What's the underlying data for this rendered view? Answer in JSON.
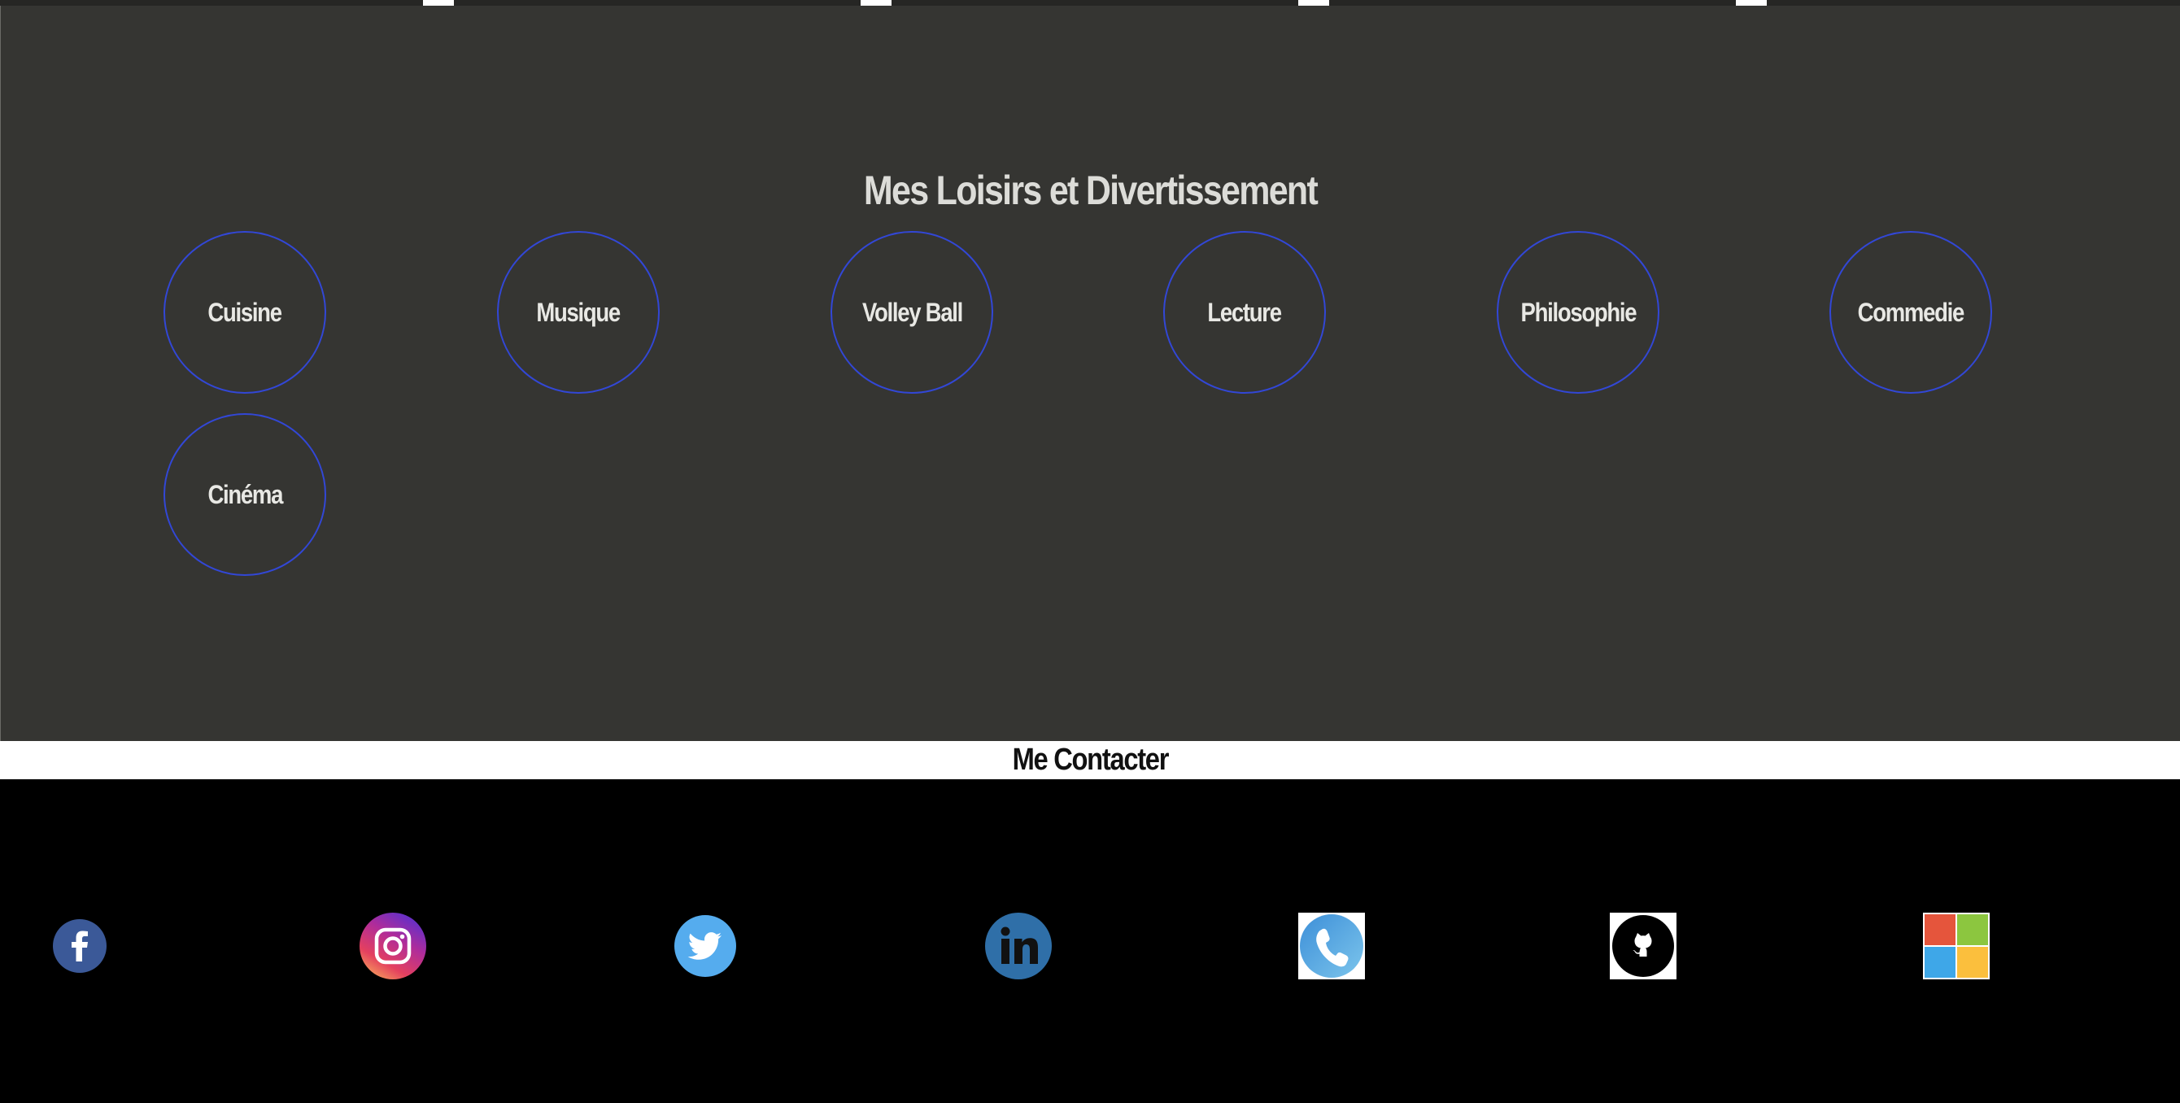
{
  "hobbies": {
    "title": "Mes Loisirs et Divertissement",
    "items": [
      "Cuisine",
      "Musique",
      "Volley Ball",
      "Lecture",
      "Philosophie",
      "Commedie",
      "Cinéma"
    ],
    "border_color": "#3247d6"
  },
  "contact": {
    "title": "Me Contacter"
  },
  "social": [
    {
      "icon": "facebook-icon",
      "color": "#3b5998"
    },
    {
      "icon": "instagram-icon",
      "color": "#c13584"
    },
    {
      "icon": "twitter-icon",
      "color": "#55acee"
    },
    {
      "icon": "linkedin-icon",
      "color": "#2f6fa8"
    },
    {
      "icon": "phone-icon",
      "color": "#4aa3df"
    },
    {
      "icon": "github-icon",
      "color": "#000000"
    },
    {
      "icon": "microsoft-icon",
      "color": "#f25022"
    }
  ]
}
